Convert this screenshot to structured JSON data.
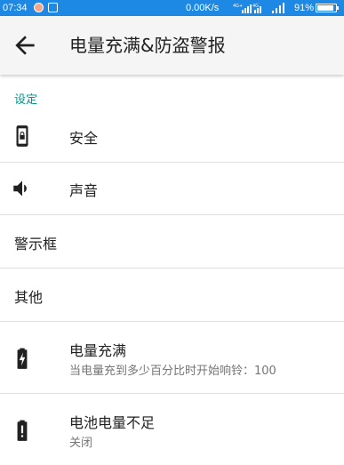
{
  "status_bar": {
    "time": "07:34",
    "net_speed": "0.00K/s",
    "battery_percent": "91%",
    "battery_level": 0.91,
    "icons": [
      "notification-icon",
      "screenshot-icon",
      "signal-icon",
      "wifi-icon",
      "battery-icon"
    ]
  },
  "app_bar": {
    "back_icon": "arrow-back-icon",
    "title": "电量充满&防盗警报"
  },
  "settings": {
    "section_header": "设定",
    "items": [
      {
        "icon": "phone-lock-icon",
        "label": "安全"
      },
      {
        "icon": "volume-icon",
        "label": "声音"
      },
      {
        "label": "警示框"
      },
      {
        "label": "其他"
      },
      {
        "icon": "battery-charging-icon",
        "label": "电量充满",
        "summary": "当电量充到多少百分比时开始响铃：100"
      },
      {
        "icon": "battery-alert-icon",
        "label": "电池电量不足",
        "summary": "关闭"
      }
    ]
  },
  "colors": {
    "status_bar": "#1e88e5",
    "app_bar": "#f5f5f5",
    "accent": "#009688",
    "divider": "#e0e0e0"
  }
}
